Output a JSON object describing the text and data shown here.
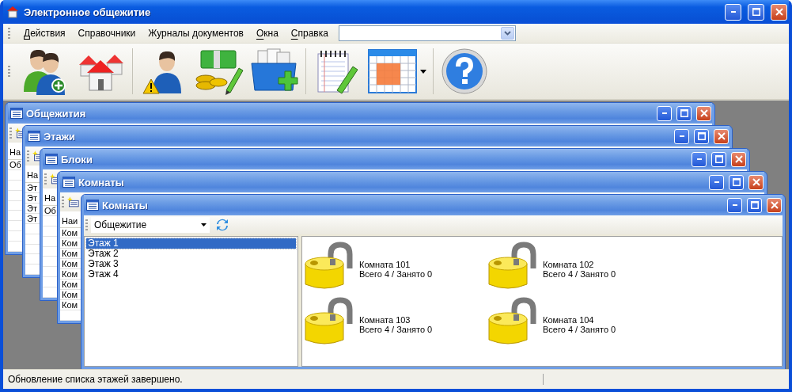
{
  "window": {
    "title": "Электронное общежитие"
  },
  "menu": [
    {
      "label": "Действия",
      "mnemonic": true
    },
    {
      "label": "Справочники",
      "mnemonic": false
    },
    {
      "label": "Журналы документов",
      "mnemonic": false
    },
    {
      "label": "Окна",
      "mnemonic": true
    },
    {
      "label": "Справка",
      "mnemonic": true
    }
  ],
  "child_windows": [
    {
      "title": "Общежития",
      "column_header": "На",
      "rows": [
        "Об"
      ]
    },
    {
      "title": "Этажи",
      "column_header": "На",
      "rows": [
        "Эт",
        "Эт",
        "Эт",
        "Эт"
      ]
    },
    {
      "title": "Блоки",
      "column_header": "На",
      "rows": [
        "Об"
      ]
    },
    {
      "title": "Комнаты",
      "column_header": "Наи",
      "rows": [
        "Ком",
        "Ком",
        "Ком",
        "Ком",
        "Ком",
        "Ком",
        "Ком",
        "Ком"
      ]
    }
  ],
  "front_window": {
    "title": "Комнаты",
    "filter": {
      "value": "Общежитие"
    },
    "floors": [
      {
        "label": "Этаж 1",
        "selected": true
      },
      {
        "label": "Этаж 2",
        "selected": false
      },
      {
        "label": "Этаж 3",
        "selected": false
      },
      {
        "label": "Этаж 4",
        "selected": false
      }
    ],
    "rooms": [
      {
        "name": "Комната 101",
        "occupancy": "Всего 4 / Занято 0"
      },
      {
        "name": "Комната 102",
        "occupancy": "Всего 4 / Занято 0"
      },
      {
        "name": "Комната 103",
        "occupancy": "Всего 4 / Занято 0"
      },
      {
        "name": "Комната 104",
        "occupancy": "Всего 4 / Занято 0"
      }
    ]
  },
  "status_bar": {
    "text": "Обновление списка этажей завершено."
  }
}
